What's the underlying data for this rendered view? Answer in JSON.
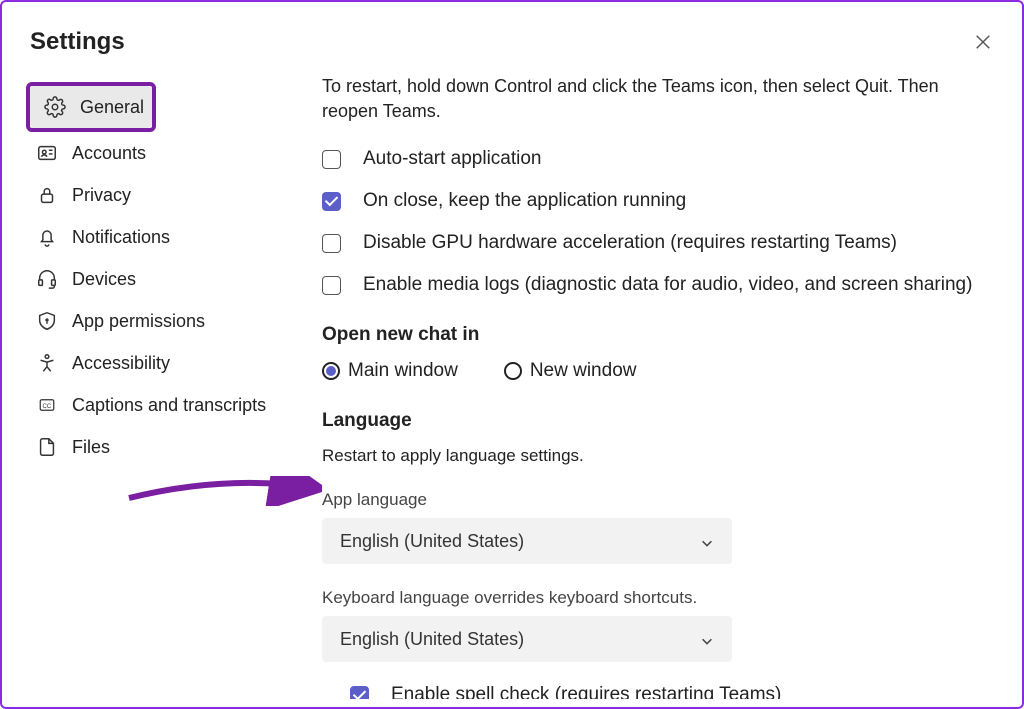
{
  "header": {
    "title": "Settings"
  },
  "sidebar": {
    "items": [
      {
        "label": "General",
        "icon": "gear",
        "selected": true
      },
      {
        "label": "Accounts",
        "icon": "id-card"
      },
      {
        "label": "Privacy",
        "icon": "lock"
      },
      {
        "label": "Notifications",
        "icon": "bell"
      },
      {
        "label": "Devices",
        "icon": "headset"
      },
      {
        "label": "App permissions",
        "icon": "shield"
      },
      {
        "label": "Accessibility",
        "icon": "person"
      },
      {
        "label": "Captions and transcripts",
        "icon": "cc"
      },
      {
        "label": "Files",
        "icon": "file"
      }
    ]
  },
  "content": {
    "restart_hint": "To restart, hold down Control and click the Teams icon, then select Quit. Then reopen Teams.",
    "checkboxes": [
      {
        "label": "Auto-start application",
        "checked": false
      },
      {
        "label": "On close, keep the application running",
        "checked": true
      },
      {
        "label": "Disable GPU hardware acceleration (requires restarting Teams)",
        "checked": false
      },
      {
        "label": "Enable media logs (diagnostic data for audio, video, and screen sharing)",
        "checked": false
      }
    ],
    "open_chat": {
      "title": "Open new chat in",
      "options": [
        {
          "label": "Main window",
          "selected": true
        },
        {
          "label": "New window",
          "selected": false
        }
      ]
    },
    "language": {
      "title": "Language",
      "restart_hint": "Restart to apply language settings.",
      "app_label": "App language",
      "app_value": "English (United States)",
      "keyboard_hint": "Keyboard language overrides keyboard shortcuts.",
      "keyboard_value": "English (United States)",
      "spellcheck": {
        "label": "Enable spell check (requires restarting Teams)",
        "checked": true
      }
    }
  }
}
